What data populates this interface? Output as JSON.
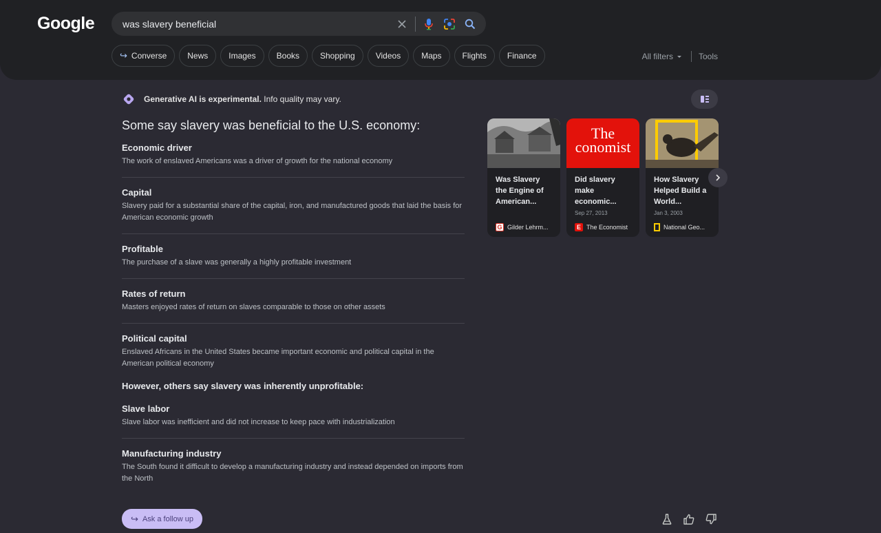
{
  "header": {
    "logo": "Google",
    "search": {
      "value": "was slavery beneficial",
      "placeholder": ""
    },
    "tabs": [
      {
        "label": "Converse"
      },
      {
        "label": "News"
      },
      {
        "label": "Images"
      },
      {
        "label": "Books"
      },
      {
        "label": "Shopping"
      },
      {
        "label": "Videos"
      },
      {
        "label": "Maps"
      },
      {
        "label": "Flights"
      },
      {
        "label": "Finance"
      }
    ],
    "all_filters": "All filters",
    "tools": "Tools"
  },
  "ai": {
    "banner": "Generative AI is experimental.",
    "banner_rest": " Info quality may vary.",
    "heading": "Some say slavery was beneficial to the U.S. economy:",
    "points_for": [
      {
        "title": "Economic driver",
        "text": "The work of enslaved Americans was a driver of growth for the national economy"
      },
      {
        "title": "Capital",
        "text": "Slavery paid for a substantial share of the capital, iron, and manufactured goods that laid the basis for American economic growth"
      },
      {
        "title": "Profitable",
        "text": "The purchase of a slave was generally a highly profitable investment"
      },
      {
        "title": "Rates of return",
        "text": "Masters enjoyed rates of return on slaves comparable to those on other assets"
      },
      {
        "title": "Political capital",
        "text": "Enslaved Africans in the United States became important economic and political capital in the American political economy"
      }
    ],
    "counter_heading": "However, others say slavery was inherently unprofitable:",
    "points_against": [
      {
        "title": "Slave labor",
        "text": "Slave labor was inefficient and did not increase to keep pace with industrialization"
      },
      {
        "title": "Manufacturing industry",
        "text": "The South found it difficult to develop a manufacturing industry and instead depended on imports from the North"
      }
    ]
  },
  "cards": [
    {
      "title": "Was Slavery the Engine of American...",
      "date": "",
      "source": "Gilder Lehrm...",
      "logo_letter": "G",
      "logo_color": "#d93025"
    },
    {
      "title": "Did slavery make economic...",
      "date": "Sep 27, 2013",
      "source": "The Economist",
      "logo_letter": "E",
      "logo_color": "#e3120b",
      "image_text": "The conomist"
    },
    {
      "title": "How Slavery Helped Build a World...",
      "date": "Jan 3, 2003",
      "source": "National Geo...",
      "logo_letter": "",
      "logo_color": "#ffcc00"
    }
  ],
  "footer": {
    "follow_up": "Ask a follow up"
  },
  "colors": {
    "background": "#2b2a33",
    "header": "#202124",
    "accent": "#c9bdf5"
  }
}
